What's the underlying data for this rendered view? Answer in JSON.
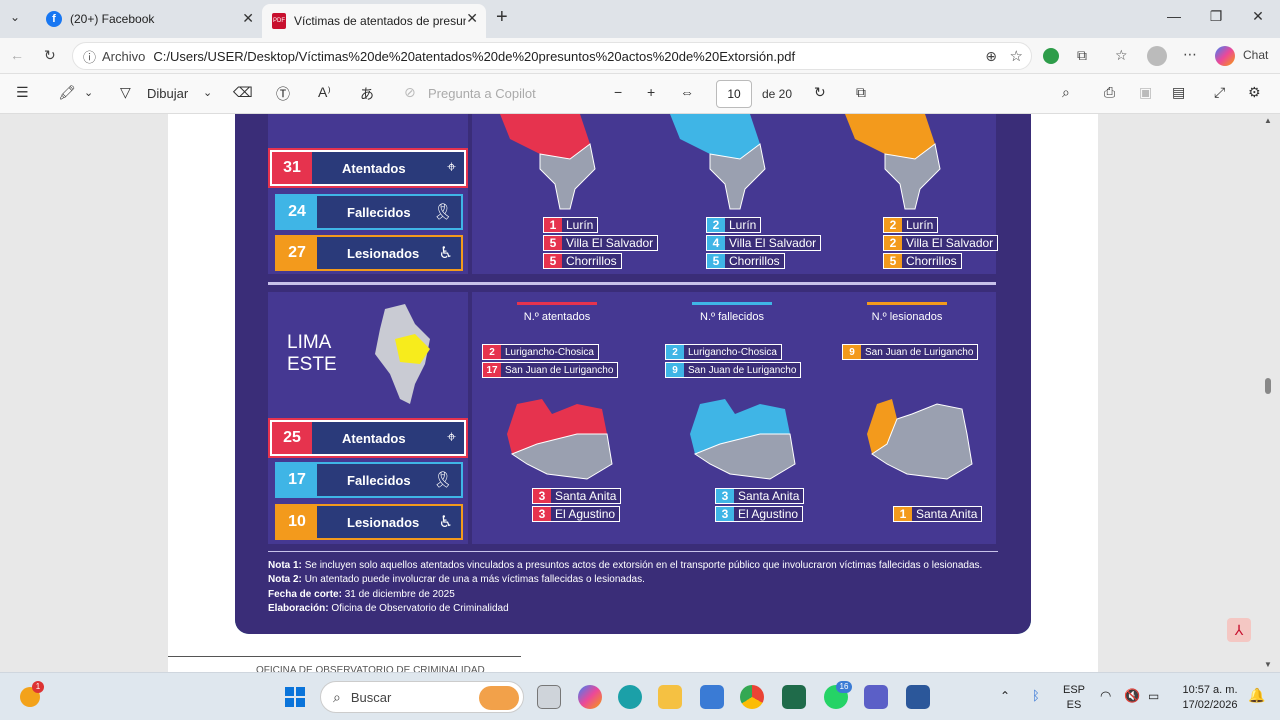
{
  "browser": {
    "tabs": [
      {
        "label": "(20+) Facebook",
        "icon": "facebook-icon",
        "active": false
      },
      {
        "label": "Víctimas de atentados de presunto",
        "icon": "pdf-icon",
        "active": true
      }
    ],
    "new_tab": "+",
    "address": {
      "site_label": "Archivo",
      "url": "C:/Users/USER/Desktop/Víctimas%20de%20atentados%20de%20presuntos%20actos%20de%20Extorsión.pdf"
    },
    "chat_label": "Chat"
  },
  "pdf_toolbar": {
    "draw_label": "Dibujar",
    "copilot_placeholder": "Pregunta a Copilot",
    "page_current": "10",
    "page_total": "de 20"
  },
  "poster": {
    "top": {
      "stats": [
        {
          "value": "31",
          "label": "Atentados",
          "color": "red"
        },
        {
          "value": "24",
          "label": "Fallecidos",
          "color": "blue"
        },
        {
          "value": "27",
          "label": "Lesionados",
          "color": "orange"
        }
      ],
      "maps": [
        {
          "color": "#e6334e",
          "tags": [
            {
              "n": "1",
              "t": "Lurín"
            },
            {
              "n": "5",
              "t": "Villa El Salvador"
            },
            {
              "n": "5",
              "t": "Chorrillos"
            }
          ]
        },
        {
          "color": "#3fb5e6",
          "tags": [
            {
              "n": "2",
              "t": "Lurín"
            },
            {
              "n": "4",
              "t": "Villa El Salvador"
            },
            {
              "n": "5",
              "t": "Chorrillos"
            }
          ]
        },
        {
          "color": "#f39a1c",
          "tags": [
            {
              "n": "2",
              "t": "Lurín"
            },
            {
              "n": "2",
              "t": "Villa El Salvador"
            },
            {
              "n": "5",
              "t": "Chorrillos"
            }
          ]
        }
      ]
    },
    "este": {
      "title_line1": "LIMA",
      "title_line2": "ESTE",
      "headers": [
        "N.º atentados",
        "N.º fallecidos",
        "N.º lesionados"
      ],
      "stats": [
        {
          "value": "25",
          "label": "Atentados",
          "color": "red"
        },
        {
          "value": "17",
          "label": "Fallecidos",
          "color": "blue"
        },
        {
          "value": "10",
          "label": "Lesionados",
          "color": "orange"
        }
      ],
      "maps": [
        {
          "color": "#e6334e",
          "top_tags": [
            {
              "n": "2",
              "t": "Lurigancho-Chosica"
            },
            {
              "n": "17",
              "t": "San Juan de Lurigancho"
            }
          ],
          "bottom_tags": [
            {
              "n": "3",
              "t": "Santa Anita"
            },
            {
              "n": "3",
              "t": "El Agustino"
            }
          ]
        },
        {
          "color": "#3fb5e6",
          "top_tags": [
            {
              "n": "2",
              "t": "Lurigancho-Chosica"
            },
            {
              "n": "9",
              "t": "San Juan de Lurigancho"
            }
          ],
          "bottom_tags": [
            {
              "n": "3",
              "t": "Santa Anita"
            },
            {
              "n": "3",
              "t": "El Agustino"
            }
          ]
        },
        {
          "color": "#f39a1c",
          "top_tags": [
            {
              "n": "9",
              "t": "San Juan de Lurigancho"
            }
          ],
          "bottom_tags": [
            {
              "n": "1",
              "t": "Santa Anita"
            }
          ]
        }
      ]
    },
    "notes": {
      "nota1_label": "Nota 1:",
      "nota1": "Se incluyen solo aquellos atentados vinculados a presuntos actos de extorsión en el transporte público que involucraron víctimas fallecidas o lesionadas.",
      "nota2_label": "Nota 2:",
      "nota2": "Un atentado puede involucrar de una a más víctimas fallecidas o lesionadas.",
      "corte_label": "Fecha de corte:",
      "corte": "31 de diciembre de 2025",
      "elab_label": "Elaboración:",
      "elab": "Oficina de Observatorio de Criminalidad"
    },
    "footer_text": "OFICINA DE OBSERVATORIO DE CRIMINALIDAD"
  },
  "taskbar": {
    "search_placeholder": "Buscar",
    "lang_top": "ESP",
    "lang_bottom": "ES",
    "time": "10:57 a. m.",
    "date": "17/02/2026",
    "notif_badge": "1",
    "whatsapp_badge": "16"
  }
}
